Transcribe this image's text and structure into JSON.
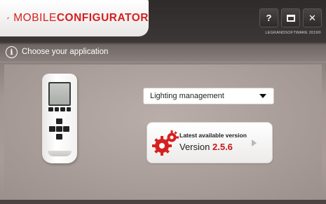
{
  "app": {
    "logo_light": "MOBILE",
    "logo_bold": "CONFIGURATOR",
    "copyright": "LEGRANDSOFTWARE 2019©"
  },
  "titlebar": {
    "help_label": "?",
    "close_label": "✕"
  },
  "info": {
    "icon_glyph": "i",
    "text": "Choose your application"
  },
  "application_select": {
    "value": "Lighting management"
  },
  "version_card": {
    "title": "Latest available version",
    "prefix": "Version",
    "number": "2.5.6"
  },
  "colors": {
    "brand_red": "#d62020",
    "version_red": "#c8181d"
  },
  "icons": [
    "gear-logo-icon",
    "help-icon",
    "maximize-icon",
    "close-icon",
    "info-icon",
    "dropdown-caret-icon",
    "gears-icon",
    "play-arrow-icon"
  ]
}
